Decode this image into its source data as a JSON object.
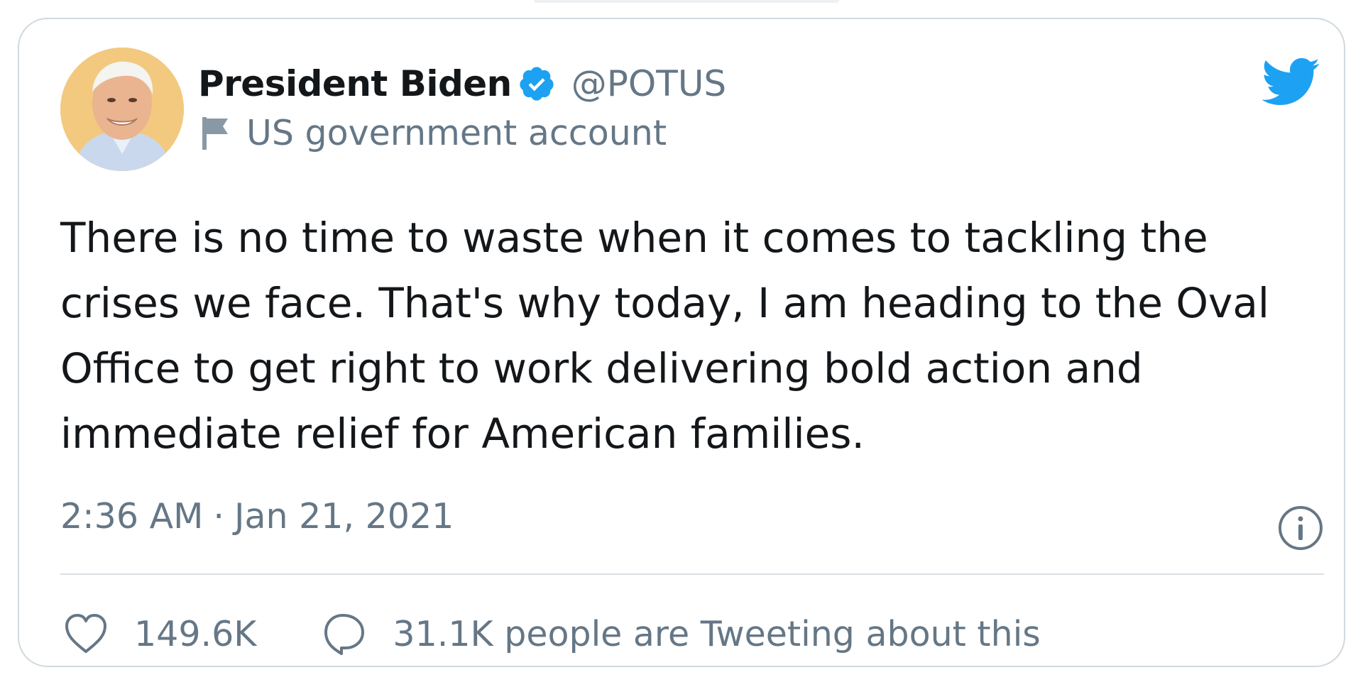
{
  "tweet": {
    "display_name": "President Biden",
    "handle": "@POTUS",
    "account_label": "US government account",
    "text": "There is no time to waste when it comes to tackling the crises we face. That's why today, I am heading to the Oval Office to get right to work delivering bold action and immediate relief for American families.",
    "time": "2:36 AM",
    "separator": "·",
    "date": "Jan 21, 2021",
    "likes": "149.6K",
    "tweeting_about": "31.1K people are Tweeting about this"
  },
  "icons": {
    "verified": "verified-badge-icon",
    "label_flag": "flag-icon",
    "brand": "twitter-bird-icon",
    "info": "info-icon",
    "like": "heart-icon",
    "reply": "speech-bubble-icon"
  },
  "colors": {
    "brand_blue": "#1da1f2",
    "text_primary": "#14171a",
    "text_secondary": "#657786",
    "border": "#cfd9de"
  }
}
